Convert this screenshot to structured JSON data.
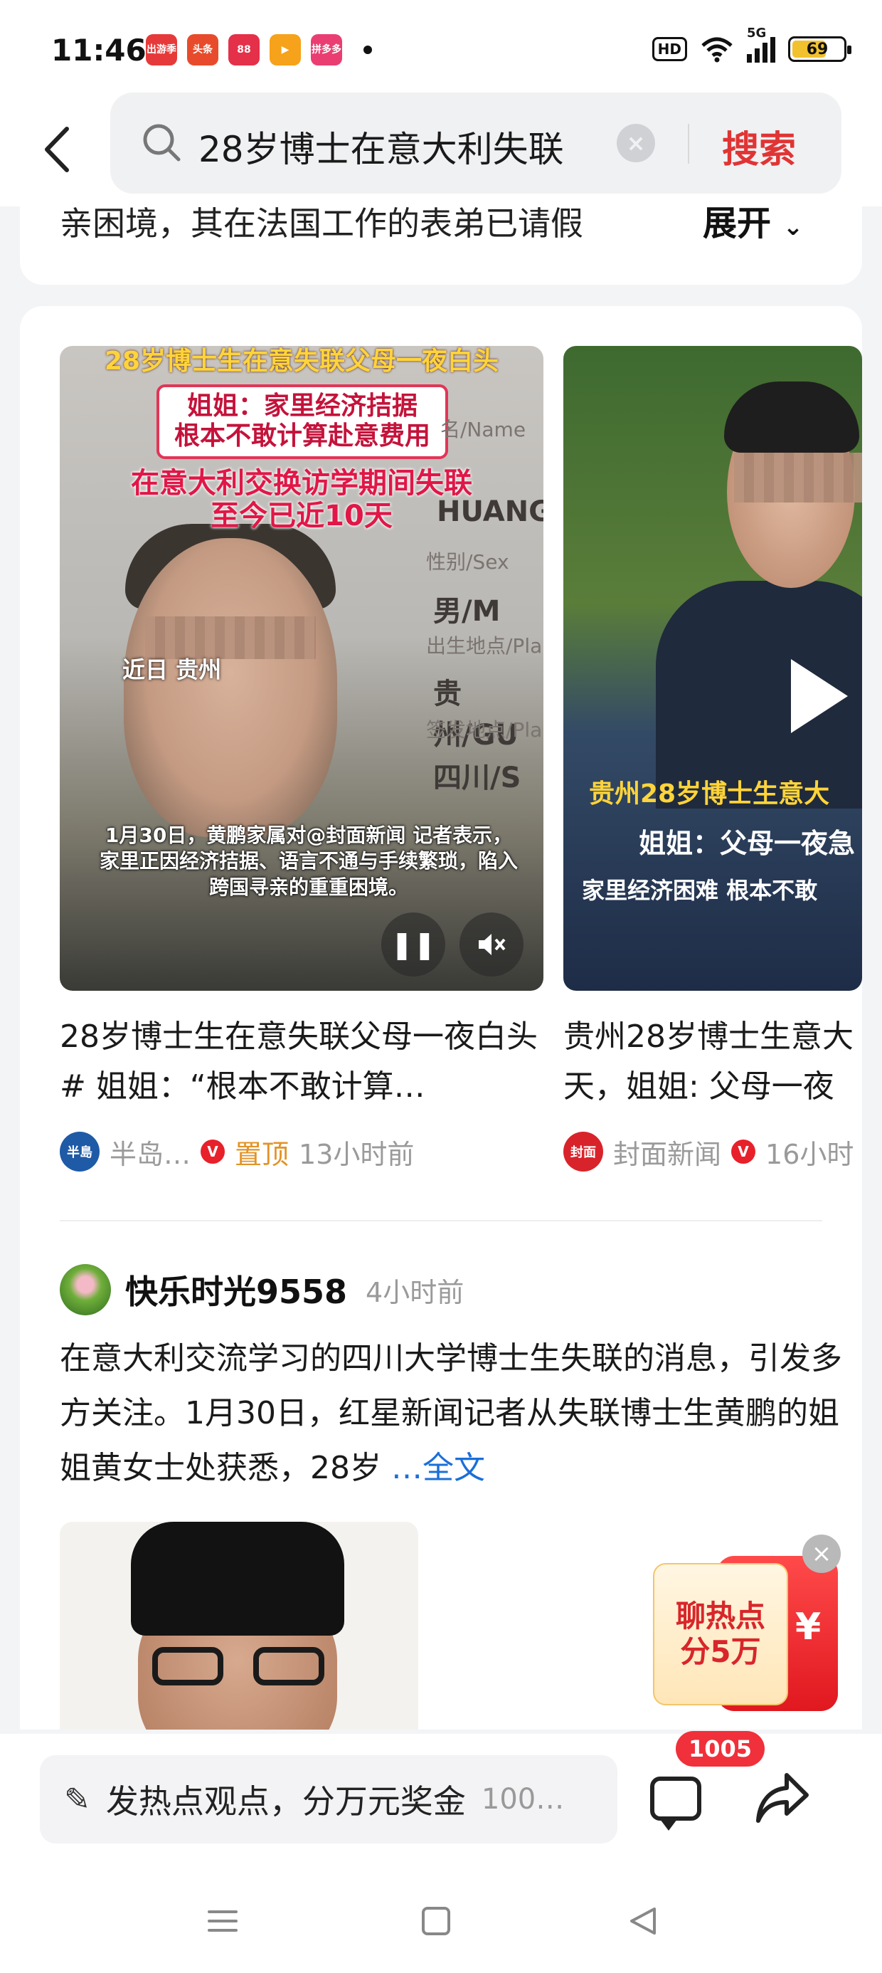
{
  "status_bar": {
    "time": "11:46",
    "app_icons": [
      {
        "name": "app-icon-1",
        "label": "出游季",
        "color": "#e63a3a"
      },
      {
        "name": "app-icon-2",
        "label": "头条",
        "color": "#e84b2b"
      },
      {
        "name": "app-icon-3",
        "label": "88",
        "color": "#e5304a"
      },
      {
        "name": "app-icon-4",
        "label": "▶",
        "color": "#f6a21a"
      },
      {
        "name": "app-icon-5",
        "label": "拼多多",
        "color": "#ea3e72"
      }
    ],
    "hd": "HD",
    "network": "5G",
    "battery": "69"
  },
  "search": {
    "query": "28岁博士在意大利失联",
    "button": "搜索"
  },
  "prev_card": {
    "text": "亲困境，其在法国工作的表弟已请假",
    "expand": "展开"
  },
  "videos": [
    {
      "overlay_title": "28岁博士生在意失联父母一夜白头",
      "sister_quote_1": "姐姐：家里经济拮据",
      "sister_quote_2": "根本不敢计算赴意费用",
      "missing_1": "在意大利交换访学期间失联",
      "missing_2": "至今已近10天",
      "place": "近日 贵州",
      "id_name_label": "名/Name",
      "id_name_value": "HUANG",
      "id_sex_label": "性别/Sex",
      "id_sex_value": "男/M",
      "id_birth_label": "出生地点/Pla",
      "id_birth_value": "贵州/GU",
      "id_issue_label": "签发地点/Pla",
      "id_issue_value": "四川/S",
      "caption": "1月30日，黄鹏家属对@封面新闻 记者表示，家里正因经济拮据、语言不通与手续繁琐，陷入跨国寻亲的重重困境。",
      "title": "28岁博士生在意失联父母一夜白头# 姐姐：“根本不敢计算…",
      "source": "半岛…",
      "pinned": "置顶",
      "time": "13小时前"
    },
    {
      "overlay_1": "贵州28岁博士生意大",
      "overlay_2": "姐姐：父母一夜急",
      "overlay_3": "家里经济困难 根本不敢",
      "title_line1": "贵州28岁博士生意大",
      "title_line2": "天，姐姐: 父母一夜",
      "source": "封面新闻",
      "source_logo": "封面",
      "time": "16小时"
    }
  ],
  "post": {
    "author": "快乐时光9558",
    "time": "4小时前",
    "body": "在意大利交流学习的四川大学博士生失联的消息，引发多方关注。1月30日，红星新闻记者从失联博士生黄鹏的姐姐黄女士处获悉，28岁 ",
    "more": "…全文"
  },
  "promo": {
    "line1": "聊热点",
    "line2": "分5万",
    "yen": "¥"
  },
  "bottom": {
    "placeholder": "发热点观点，分万元奖金",
    "count": "100…",
    "comments_badge": "1005"
  }
}
